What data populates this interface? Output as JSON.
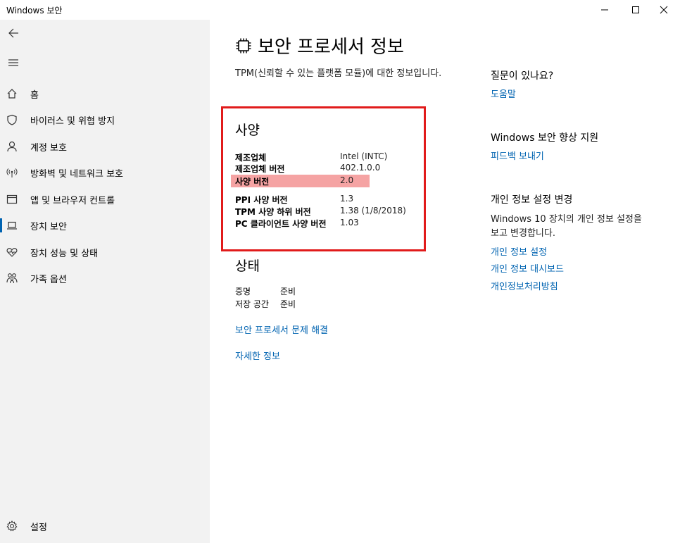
{
  "window": {
    "title": "Windows 보안"
  },
  "sidebar": {
    "items": [
      {
        "label": "홈",
        "icon": "home-icon"
      },
      {
        "label": "바이러스 및 위협 방지",
        "icon": "shield-icon"
      },
      {
        "label": "계정 보호",
        "icon": "person-icon"
      },
      {
        "label": "방화벽 및 네트워크 보호",
        "icon": "wireless-icon"
      },
      {
        "label": "앱 및 브라우저 컨트롤",
        "icon": "browser-window-icon"
      },
      {
        "label": "장치 보안",
        "icon": "laptop-icon"
      },
      {
        "label": "장치 성능 및 상태",
        "icon": "heart-pulse-icon"
      },
      {
        "label": "가족 옵션",
        "icon": "family-icon"
      }
    ],
    "settings_label": "설정",
    "selected_index": 5
  },
  "main": {
    "title": "보안 프로세서 정보",
    "description": "TPM(신뢰할 수 있는 플랫폼 모듈)에 대한 정보입니다.",
    "spec_heading": "사양",
    "specs_group1": [
      {
        "key": "제조업체",
        "value": "Intel (INTC)"
      },
      {
        "key": "제조업체 버전",
        "value": "402.1.0.0"
      },
      {
        "key": "사양 버전",
        "value": "2.0"
      }
    ],
    "specs_group2": [
      {
        "key": "PPI 사양 버전",
        "value": "1.3"
      },
      {
        "key": "TPM 사양 하위 버전",
        "value": "1.38 (1/8/2018)"
      },
      {
        "key": "PC 클라이언트 사양 버전",
        "value": "1.03"
      }
    ],
    "status_heading": "상태",
    "status": [
      {
        "key": "증명",
        "value": "준비"
      },
      {
        "key": "저장 공간",
        "value": "준비"
      }
    ],
    "troubleshoot_link": "보안 프로세서 문제 해결",
    "details_link": "자세한 정보"
  },
  "right": {
    "question_heading": "질문이 있나요?",
    "help_link": "도움말",
    "improve_heading": "Windows 보안 향상 지원",
    "feedback_link": "피드백 보내기",
    "privacy_heading": "개인 정보 설정 변경",
    "privacy_text": "Windows 10 장치의 개인 정보 설정을 보고 변경합니다.",
    "privacy_links": [
      "개인 정보 설정",
      "개인 정보 대시보드",
      "개인정보처리방침"
    ]
  },
  "colors": {
    "accent": "#0063b1",
    "highlight_box": "#e11b1b",
    "highlight_fill": "#f5a3a3",
    "sidebar_bg": "#f2f2f2"
  }
}
